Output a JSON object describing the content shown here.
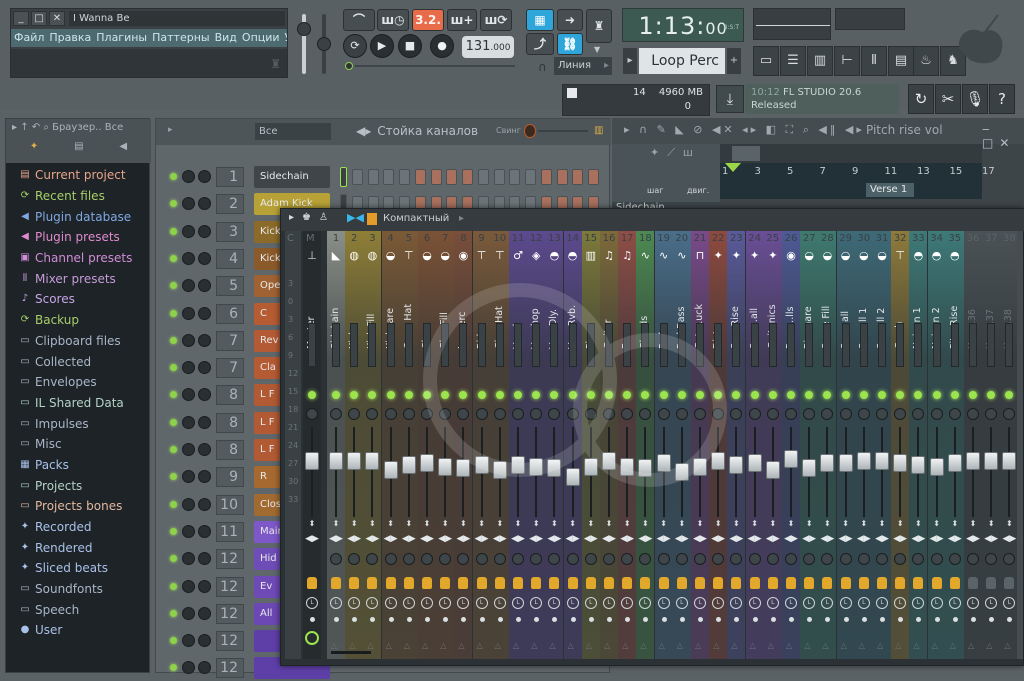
{
  "window": {
    "song_title": "I Wanna Be",
    "menu": [
      "Файл",
      "Правка",
      "Плагины",
      "Паттерны",
      "Вид",
      "Опции",
      "Утилиты",
      "?"
    ],
    "minimize": "_",
    "maximize": "□",
    "close": "✕"
  },
  "transport": {
    "pattern_song_mode": "3.2.",
    "tempo_value": "131",
    "tempo_decimals": ".000",
    "snap_mode": "Линия",
    "time_main": "1:13:",
    "time_small": "00",
    "time_format_label": "B:S:T",
    "pattern_name": "Loop Perc",
    "pattern_prev": "▸",
    "pattern_add": "+",
    "play": "▶",
    "stop": "■",
    "record": "●"
  },
  "toolbar_icons": [
    "playlist-icon",
    "channel-rack-icon",
    "piano-roll-icon",
    "browser-icon",
    "mixer-icon",
    "templates-icon",
    "plugin-picker-icon",
    "touch-controller-icon"
  ],
  "status": {
    "cpu": "14",
    "memory": "4960 MB",
    "polyphony": "0",
    "news_time": "10:12",
    "news_title": "FL STUDIO 20.6",
    "news_subtitle": "Released"
  },
  "browser": {
    "title": "Браузер..",
    "filter": "Все",
    "items": [
      {
        "label": "Current project",
        "icon": "▤",
        "color": "#e8a48a",
        "icon_name": "project-icon"
      },
      {
        "label": "Recent files",
        "icon": "⟳",
        "color": "#a6cf6a",
        "icon_name": "recent-folder-icon"
      },
      {
        "label": "Plugin database",
        "icon": "◀",
        "color": "#7fa8e0",
        "icon_name": "plugin-database-icon"
      },
      {
        "label": "Plugin presets",
        "icon": "◀",
        "color": "#e08bcf",
        "icon_name": "plugin-presets-icon"
      },
      {
        "label": "Channel presets",
        "icon": "▣",
        "color": "#d28cd8",
        "icon_name": "channel-presets-icon"
      },
      {
        "label": "Mixer presets",
        "icon": "⫴",
        "color": "#c69bd8",
        "icon_name": "mixer-presets-icon"
      },
      {
        "label": "Scores",
        "icon": "♪",
        "color": "#c7a5e6",
        "icon_name": "scores-icon"
      },
      {
        "label": "Backup",
        "icon": "⟳",
        "color": "#a6cf6a",
        "icon_name": "backup-folder-icon"
      },
      {
        "label": "Clipboard files",
        "icon": "▭",
        "color": "#a9b6c8",
        "icon_name": "folder-icon"
      },
      {
        "label": "Collected",
        "icon": "▭",
        "color": "#a9b6c8",
        "icon_name": "folder-icon"
      },
      {
        "label": "Envelopes",
        "icon": "▭",
        "color": "#a9b6c8",
        "icon_name": "folder-icon"
      },
      {
        "label": "IL Shared Data",
        "icon": "▭",
        "color": "#b4d2c5",
        "icon_name": "shared-folder-icon"
      },
      {
        "label": "Impulses",
        "icon": "▭",
        "color": "#a9b6c8",
        "icon_name": "folder-icon"
      },
      {
        "label": "Misc",
        "icon": "▭",
        "color": "#a9b6c8",
        "icon_name": "folder-icon"
      },
      {
        "label": "Packs",
        "icon": "▦",
        "color": "#a9c1e8",
        "icon_name": "packs-icon"
      },
      {
        "label": "Projects",
        "icon": "▭",
        "color": "#b4d2c5",
        "icon_name": "projects-folder-icon"
      },
      {
        "label": "Projects bones",
        "icon": "▭",
        "color": "#e3b7a0",
        "icon_name": "projects-bones-folder-icon"
      },
      {
        "label": "Recorded",
        "icon": "✦",
        "color": "#a9c1e8",
        "icon_name": "recorded-icon"
      },
      {
        "label": "Rendered",
        "icon": "✦",
        "color": "#a9c1e8",
        "icon_name": "rendered-icon"
      },
      {
        "label": "Sliced beats",
        "icon": "✦",
        "color": "#a9c1e8",
        "icon_name": "sliced-beats-icon"
      },
      {
        "label": "Soundfonts",
        "icon": "▭",
        "color": "#a9b6c8",
        "icon_name": "folder-icon"
      },
      {
        "label": "Speech",
        "icon": "▭",
        "color": "#a9b6c8",
        "icon_name": "folder-icon"
      },
      {
        "label": "User",
        "icon": "●",
        "color": "#a9c1e8",
        "icon_name": "user-icon"
      }
    ]
  },
  "channel_rack": {
    "title": "Стойка каналов",
    "filter": "Все",
    "swing_label": "Свинг",
    "channels": [
      {
        "num": "1",
        "name": "Sidechain",
        "color": "#3f4548"
      },
      {
        "num": "2",
        "name": "Adam Kick",
        "color": "#b8a136"
      },
      {
        "num": "3",
        "name": "Kick",
        "color": "#8b6a2a"
      },
      {
        "num": "4",
        "name": "Kick",
        "color": "#8b5a2a"
      },
      {
        "num": "5",
        "name": "Open",
        "color": "#a06232"
      },
      {
        "num": "6",
        "name": "C",
        "color": "#b55c33"
      },
      {
        "num": "7",
        "name": "Rev",
        "color": "#b45a34"
      },
      {
        "num": "7",
        "name": "Cla",
        "color": "#b55b33"
      },
      {
        "num": "8",
        "name": "L F",
        "color": "#b15a34"
      },
      {
        "num": "8",
        "name": "L F",
        "color": "#b15a34"
      },
      {
        "num": "8",
        "name": "L F",
        "color": "#b15a34"
      },
      {
        "num": "9",
        "name": "R",
        "color": "#a66a30"
      },
      {
        "num": "10",
        "name": "Clos",
        "color": "#a16a30"
      },
      {
        "num": "11",
        "name": "Main",
        "color": "#7e57c8"
      },
      {
        "num": "12",
        "name": "Hid",
        "color": "#6f4db8"
      },
      {
        "num": "12",
        "name": "Ev",
        "color": "#6e4ab6"
      },
      {
        "num": "12",
        "name": "All",
        "color": "#6b48b3"
      },
      {
        "num": "12",
        "name": "",
        "color": "#5e3fa8"
      },
      {
        "num": "12",
        "name": "",
        "color": "#5e3fa8"
      }
    ],
    "steps_row1": [
      0,
      0,
      0,
      0,
      1,
      1,
      1,
      1,
      0,
      0,
      0,
      0,
      1,
      1,
      1,
      1
    ]
  },
  "playlist": {
    "title": "Pitch rise vol",
    "ruler": [
      "1",
      "3",
      "5",
      "7",
      "9",
      "11",
      "13",
      "15",
      "17"
    ],
    "marker": "Verse 1",
    "first_track": "Sidechain",
    "step_label": "шаг",
    "move_label": "двиг."
  },
  "mixer": {
    "view_mode": "Компактный",
    "header_c": "C",
    "header_m": "M",
    "db_scale": [
      "3",
      "0",
      "3",
      "6",
      "9",
      "12",
      "15",
      "18",
      "21",
      "24",
      "27",
      "30",
      "33"
    ],
    "master": {
      "name": "Master",
      "fader": 0.72
    },
    "tracks": [
      {
        "num": "1",
        "name": "Sid..hain",
        "color": "#8a8f88",
        "icon": "◣",
        "fader": 0.72
      },
      {
        "num": "2",
        "name": "Kick",
        "color": "#8f7f36",
        "icon": "◍",
        "fader": 0.72
      },
      {
        "num": "3",
        "name": "Kick Fill",
        "color": "#8f7f36",
        "icon": "◍",
        "fader": 0.72
      },
      {
        "num": "4",
        "name": "Kick..are",
        "color": "#7b5a36",
        "icon": "◒",
        "fader": 0.62
      },
      {
        "num": "5",
        "name": "Open Hat",
        "color": "#7b5a36",
        "icon": "⊤",
        "fader": 0.68
      },
      {
        "num": "6",
        "name": "Clap",
        "color": "#7b5236",
        "icon": "◒",
        "fader": 0.7
      },
      {
        "num": "7",
        "name": "Clap Fill",
        "color": "#7b5236",
        "icon": "◒",
        "fader": 0.66
      },
      {
        "num": "8",
        "name": "Loo..erc",
        "color": "#7a4e3a",
        "icon": "◉",
        "fader": 0.64
      },
      {
        "num": "9",
        "name": "Ride",
        "color": "#7a5a3a",
        "icon": "⊤",
        "fader": 0.68
      },
      {
        "num": "10",
        "name": "Clos..Hat",
        "color": "#7a5a3a",
        "icon": "⊤",
        "fader": 0.62
      },
      {
        "num": "11",
        "name": "Vocal",
        "color": "#5c4a8e",
        "icon": "♂",
        "fader": 0.68
      },
      {
        "num": "12",
        "name": "Voc..hop",
        "color": "#5c4a8e",
        "icon": "◈",
        "fader": 0.66
      },
      {
        "num": "13",
        "name": "Voc..Dly.",
        "color": "#5c4a8e",
        "icon": "◓",
        "fader": 0.64
      },
      {
        "num": "14",
        "name": "Voc..Rvb.",
        "color": "#5c4a8e",
        "icon": "◓",
        "fader": 0.55
      },
      {
        "num": "15",
        "name": "Piano",
        "color": "#7d7a3a",
        "icon": "▥",
        "fader": 0.66
      },
      {
        "num": "16",
        "name": "Guitar",
        "color": "#7d6a3a",
        "icon": "♫",
        "fader": 0.72
      },
      {
        "num": "17",
        "name": "Bass",
        "color": "#8e4e46",
        "icon": "♫",
        "fader": 0.66
      },
      {
        "num": "18",
        "name": "Chords",
        "color": "#4d8a52",
        "icon": "∿",
        "fader": 0.64
      },
      {
        "num": "19",
        "name": "Pad",
        "color": "#4a6e8a",
        "icon": "∿",
        "fader": 0.7
      },
      {
        "num": "20",
        "name": "Pad Bass",
        "color": "#4a6e8a",
        "icon": "∿",
        "fader": 0.6
      },
      {
        "num": "21",
        "name": "Cute..uck",
        "color": "#7a4a8a",
        "icon": "⊓",
        "fader": 0.66
      },
      {
        "num": "22",
        "name": "Dist",
        "color": "#8e4a3e",
        "icon": "✦",
        "fader": 0.72
      },
      {
        "num": "23",
        "name": "Saw Rise",
        "color": "#5a5a9a",
        "icon": "✦",
        "fader": 0.68
      },
      {
        "num": "24",
        "name": "Squa..all",
        "color": "#6a4e96",
        "icon": "✦",
        "fader": 0.7
      },
      {
        "num": "25",
        "name": "Guit..nics",
        "color": "#6a4e96",
        "icon": "✦",
        "fader": 0.62
      },
      {
        "num": "26",
        "name": "Percu..lls",
        "color": "#4e5a96",
        "icon": "◉",
        "fader": 0.74
      },
      {
        "num": "27",
        "name": "Big..nare",
        "color": "#3e7a70",
        "icon": "◒",
        "fader": 0.64
      },
      {
        "num": "28",
        "name": "Snare Fill",
        "color": "#3e7a70",
        "icon": "◒",
        "fader": 0.7
      },
      {
        "num": "29",
        "name": "Snar..all",
        "color": "#3e6a78",
        "icon": "◒",
        "fader": 0.7
      },
      {
        "num": "30",
        "name": "Snar..ll 1",
        "color": "#3e6a78",
        "icon": "◒",
        "fader": 0.72
      },
      {
        "num": "31",
        "name": "Snar..ll 2",
        "color": "#3e6a78",
        "icon": "◒",
        "fader": 0.72
      },
      {
        "num": "32",
        "name": "Crash",
        "color": "#8e7a3a",
        "icon": "⊤",
        "fader": 0.7
      },
      {
        "num": "33",
        "name": "Nois..n 1",
        "color": "#3e7a78",
        "icon": "◓",
        "fader": 0.68
      },
      {
        "num": "34",
        "name": "Nois..n 2",
        "color": "#3e7a78",
        "icon": "◓",
        "fader": 0.66
      },
      {
        "num": "35",
        "name": "Pitc..Rise",
        "color": "#3e7a78",
        "icon": "◓",
        "fader": 0.7
      },
      {
        "num": "36",
        "name": "Кан...36",
        "color": "#4a5256",
        "icon": "",
        "fader": 0.72
      },
      {
        "num": "37",
        "name": "Кан...37",
        "color": "#4a5256",
        "icon": "",
        "fader": 0.72
      },
      {
        "num": "38",
        "name": "Кан...38",
        "color": "#4a5256",
        "icon": "",
        "fader": 0.72
      }
    ]
  }
}
